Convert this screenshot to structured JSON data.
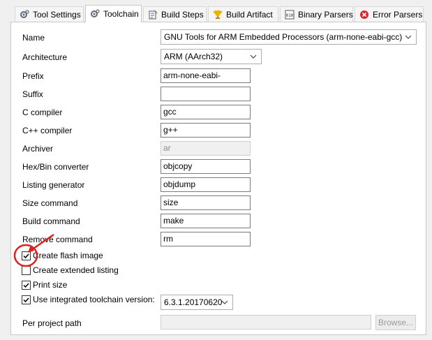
{
  "tabs": [
    {
      "label": "Tool Settings",
      "icon": "gears-icon"
    },
    {
      "label": "Toolchain",
      "icon": "gears-icon"
    },
    {
      "label": "Build Steps",
      "icon": "build-steps-icon"
    },
    {
      "label": "Build Artifact",
      "icon": "trophy-icon"
    },
    {
      "label": "Binary Parsers",
      "icon": "binary-icon"
    },
    {
      "label": "Error Parsers",
      "icon": "error-icon"
    }
  ],
  "active_tab": "Toolchain",
  "form": {
    "name_label": "Name",
    "name_value": "GNU Tools for ARM Embedded Processors (arm-none-eabi-gcc)",
    "architecture_label": "Architecture",
    "architecture_value": "ARM (AArch32)",
    "prefix_label": "Prefix",
    "prefix_value": "arm-none-eabi-",
    "suffix_label": "Suffix",
    "suffix_value": "",
    "c_compiler_label": "C compiler",
    "c_compiler_value": "gcc",
    "cpp_compiler_label": "C++ compiler",
    "cpp_compiler_value": "g++",
    "archiver_label": "Archiver",
    "archiver_value": "ar",
    "hexbin_label": "Hex/Bin converter",
    "hexbin_value": "objcopy",
    "listing_label": "Listing generator",
    "listing_value": "objdump",
    "size_label": "Size command",
    "size_value": "size",
    "build_label": "Build command",
    "build_value": "make",
    "remove_label": "Remove command",
    "remove_value": "rm"
  },
  "options": {
    "flash_label": "Create flash image",
    "flash_checked": true,
    "extended_label": "Create extended listing",
    "extended_checked": false,
    "printsize_label": "Print size",
    "printsize_checked": true,
    "integrated_label": "Use integrated toolchain version:",
    "integrated_checked": true,
    "toolchain_version": "6.3.1.20170620"
  },
  "per_project": {
    "label": "Per project path",
    "value": "",
    "browse_label": "Browse..."
  },
  "annotation_color": "#e02020"
}
